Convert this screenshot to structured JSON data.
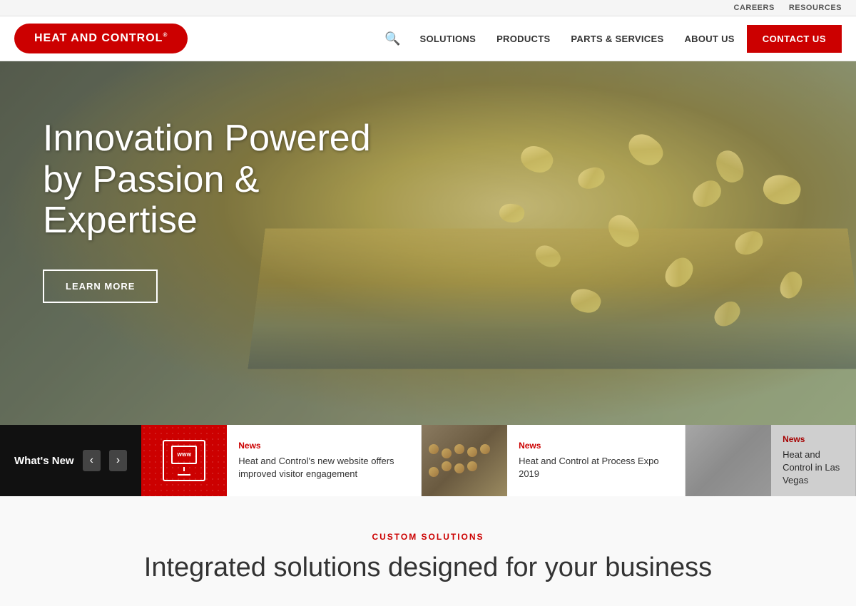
{
  "utility": {
    "careers": "CAREERS",
    "resources": "RESOURCES"
  },
  "header": {
    "logo_text": "HEAT AND CONTROL",
    "logo_reg": "®",
    "nav": {
      "search_label": "search",
      "solutions": "SOLUTIONS",
      "products": "PRODUCTS",
      "parts_services": "PARTS & SERVICES",
      "about_us": "ABOUT US",
      "contact_us": "CONTACT US"
    }
  },
  "hero": {
    "title": "Innovation Powered by Passion & Expertise",
    "learn_more": "LEARN MORE"
  },
  "whats_new": {
    "label": "What's New",
    "prev_label": "‹",
    "next_label": "›",
    "cards": [
      {
        "tag": "News",
        "headline": "Heat and Control's new website offers improved visitor engagement",
        "image_type": "www"
      },
      {
        "tag": "News",
        "headline": "Heat and Control at Process Expo 2019",
        "image_type": "food"
      },
      {
        "tag": "News",
        "headline": "Heat and Control in Las Vegas",
        "image_type": "gray"
      }
    ]
  },
  "custom_solutions": {
    "tag": "CUSTOM SOLUTIONS",
    "heading": "Integrated solutions designed for your business"
  }
}
